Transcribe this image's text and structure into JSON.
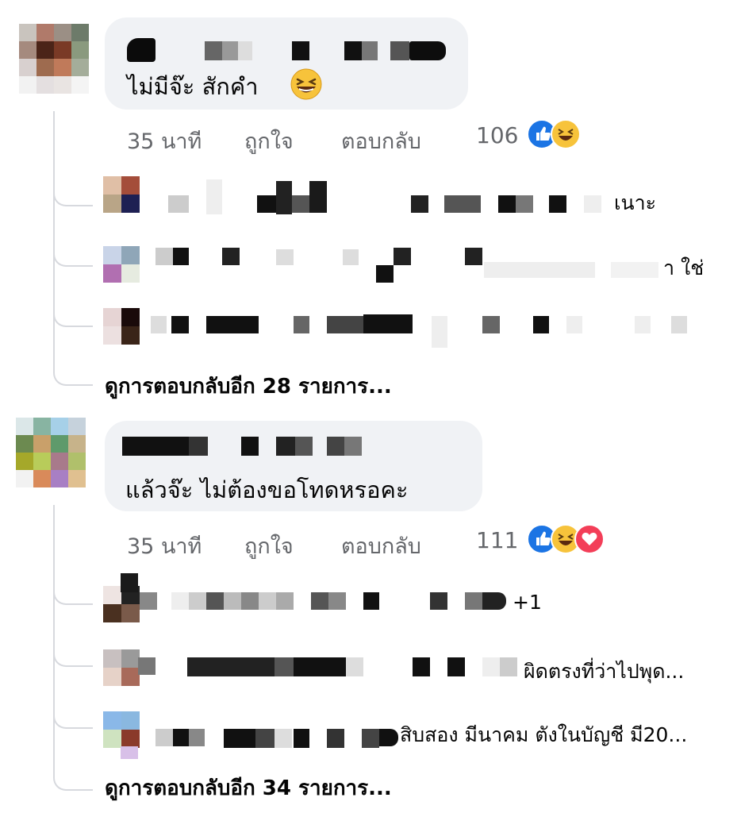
{
  "comments": [
    {
      "text": "ไม่มีจ๊ะ สักคำ",
      "emoji": "laughing-emoji",
      "time": "35 นาที",
      "like_label": "ถูกใจ",
      "reply_label": "ตอบกลับ",
      "reaction_count": "106",
      "reactions": [
        "like",
        "haha"
      ],
      "replies": [
        {
          "visible_text": "เนาะ"
        },
        {
          "visible_text": "า ใช่"
        },
        {
          "visible_text": ""
        }
      ],
      "more_replies": "ดูการตอบกลับอีก 28 รายการ..."
    },
    {
      "text": "แล้วจ๊ะ ไม่ต้องขอโทดหรอคะ",
      "time": "35 นาที",
      "like_label": "ถูกใจ",
      "reply_label": "ตอบกลับ",
      "reaction_count": "111",
      "reactions": [
        "like",
        "haha",
        "love"
      ],
      "replies": [
        {
          "visible_text": "+1"
        },
        {
          "visible_text": "ผิดตรงที่ว่าไปพุด..."
        },
        {
          "visible_text": "สิบสอง มีนาคม ตังในบัญชี มี20..."
        }
      ],
      "more_replies": "ดูการตอบกลับอีก 34 รายการ..."
    }
  ],
  "colors": {
    "bubble": "#f0f2f5",
    "meta_text": "#65676b",
    "like_blue": "#1b74e4",
    "haha_yellow": "#f7c33b",
    "love_red": "#f33e58",
    "thread_line": "#d7d9de"
  }
}
